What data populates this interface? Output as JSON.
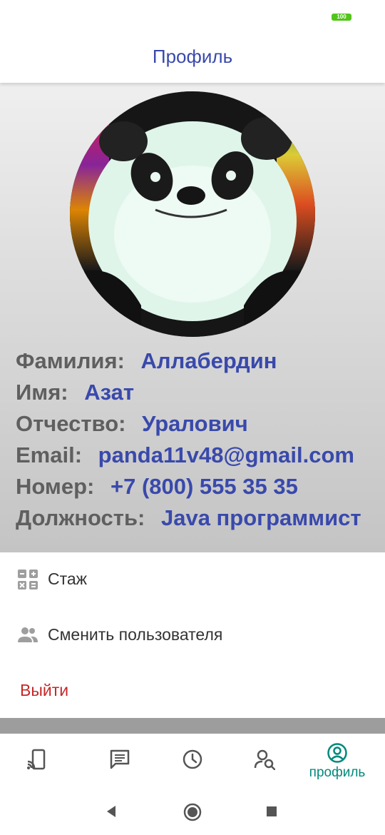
{
  "status_bar": {
    "battery": "100"
  },
  "app_bar": {
    "title": "Профиль"
  },
  "profile": {
    "fields": [
      {
        "label": "Фамилия:",
        "value": "Аллабердин"
      },
      {
        "label": "Имя:",
        "value": "Азат"
      },
      {
        "label": "Отчество:",
        "value": "Уралович"
      },
      {
        "label": "Email:",
        "value": "panda11v48@gmail.com"
      },
      {
        "label": "Номер:",
        "value": "+7 (800) 555 35 35"
      },
      {
        "label": "Должность:",
        "value": "Java программист"
      }
    ]
  },
  "menu": {
    "experience": "Стаж",
    "switch_user": "Сменить пользователя",
    "logout": "Выйти"
  },
  "bottom_nav": {
    "active_label": "профиль"
  },
  "colors": {
    "accent_blue": "#3949ab",
    "active_nav": "#00897b",
    "logout_red": "#c62828"
  }
}
